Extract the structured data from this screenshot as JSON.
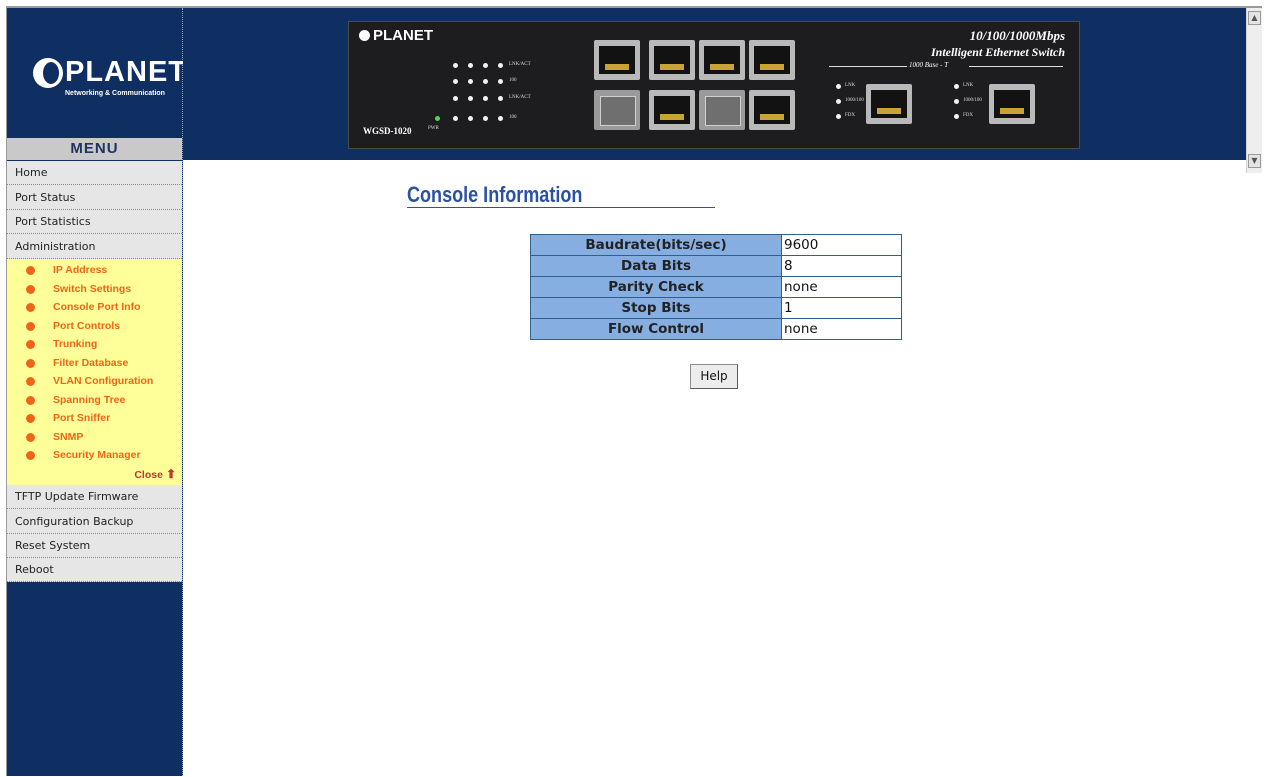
{
  "brand": {
    "name": "PLANET",
    "tagline": "Networking & Communication"
  },
  "device": {
    "model": "WGSD-1020",
    "title_line1": "10/100/1000Mbps",
    "title_line2": "Intelligent Ethernet Switch",
    "base_t": "1000 Base - T",
    "led_labels": [
      "LNK/ACT",
      "100",
      "LNK/ACT",
      "100"
    ],
    "pwr_label": "PWR",
    "gig_led_labels": [
      "LNK",
      "1000/100",
      "FDX"
    ]
  },
  "menu": {
    "heading": "MENU",
    "items_top": [
      "Home",
      "Port Status",
      "Port Statistics",
      "Administration"
    ],
    "admin_items": [
      "IP Address",
      "Switch Settings",
      "Console Port Info",
      "Port Controls",
      "Trunking",
      "Filter Database",
      "VLAN Configuration",
      "Spanning Tree",
      "Port Sniffer",
      "SNMP",
      "Security Manager"
    ],
    "close_label": "Close",
    "items_bottom": [
      "TFTP Update Firmware",
      "Configuration Backup",
      "Reset System",
      "Reboot"
    ]
  },
  "page": {
    "title": "Console Information",
    "rows": [
      {
        "label": "Baudrate(bits/sec)",
        "value": "9600"
      },
      {
        "label": "Data Bits",
        "value": "8"
      },
      {
        "label": "Parity Check",
        "value": "none"
      },
      {
        "label": "Stop Bits",
        "value": "1"
      },
      {
        "label": "Flow Control",
        "value": "none"
      }
    ],
    "help_label": "Help"
  },
  "colors": {
    "nav_bg": "#0f2e62",
    "submenu_bg": "#ffff99",
    "submenu_text": "#f06418",
    "title_color": "#2a50a8",
    "table_label_bg": "#87aee0"
  }
}
